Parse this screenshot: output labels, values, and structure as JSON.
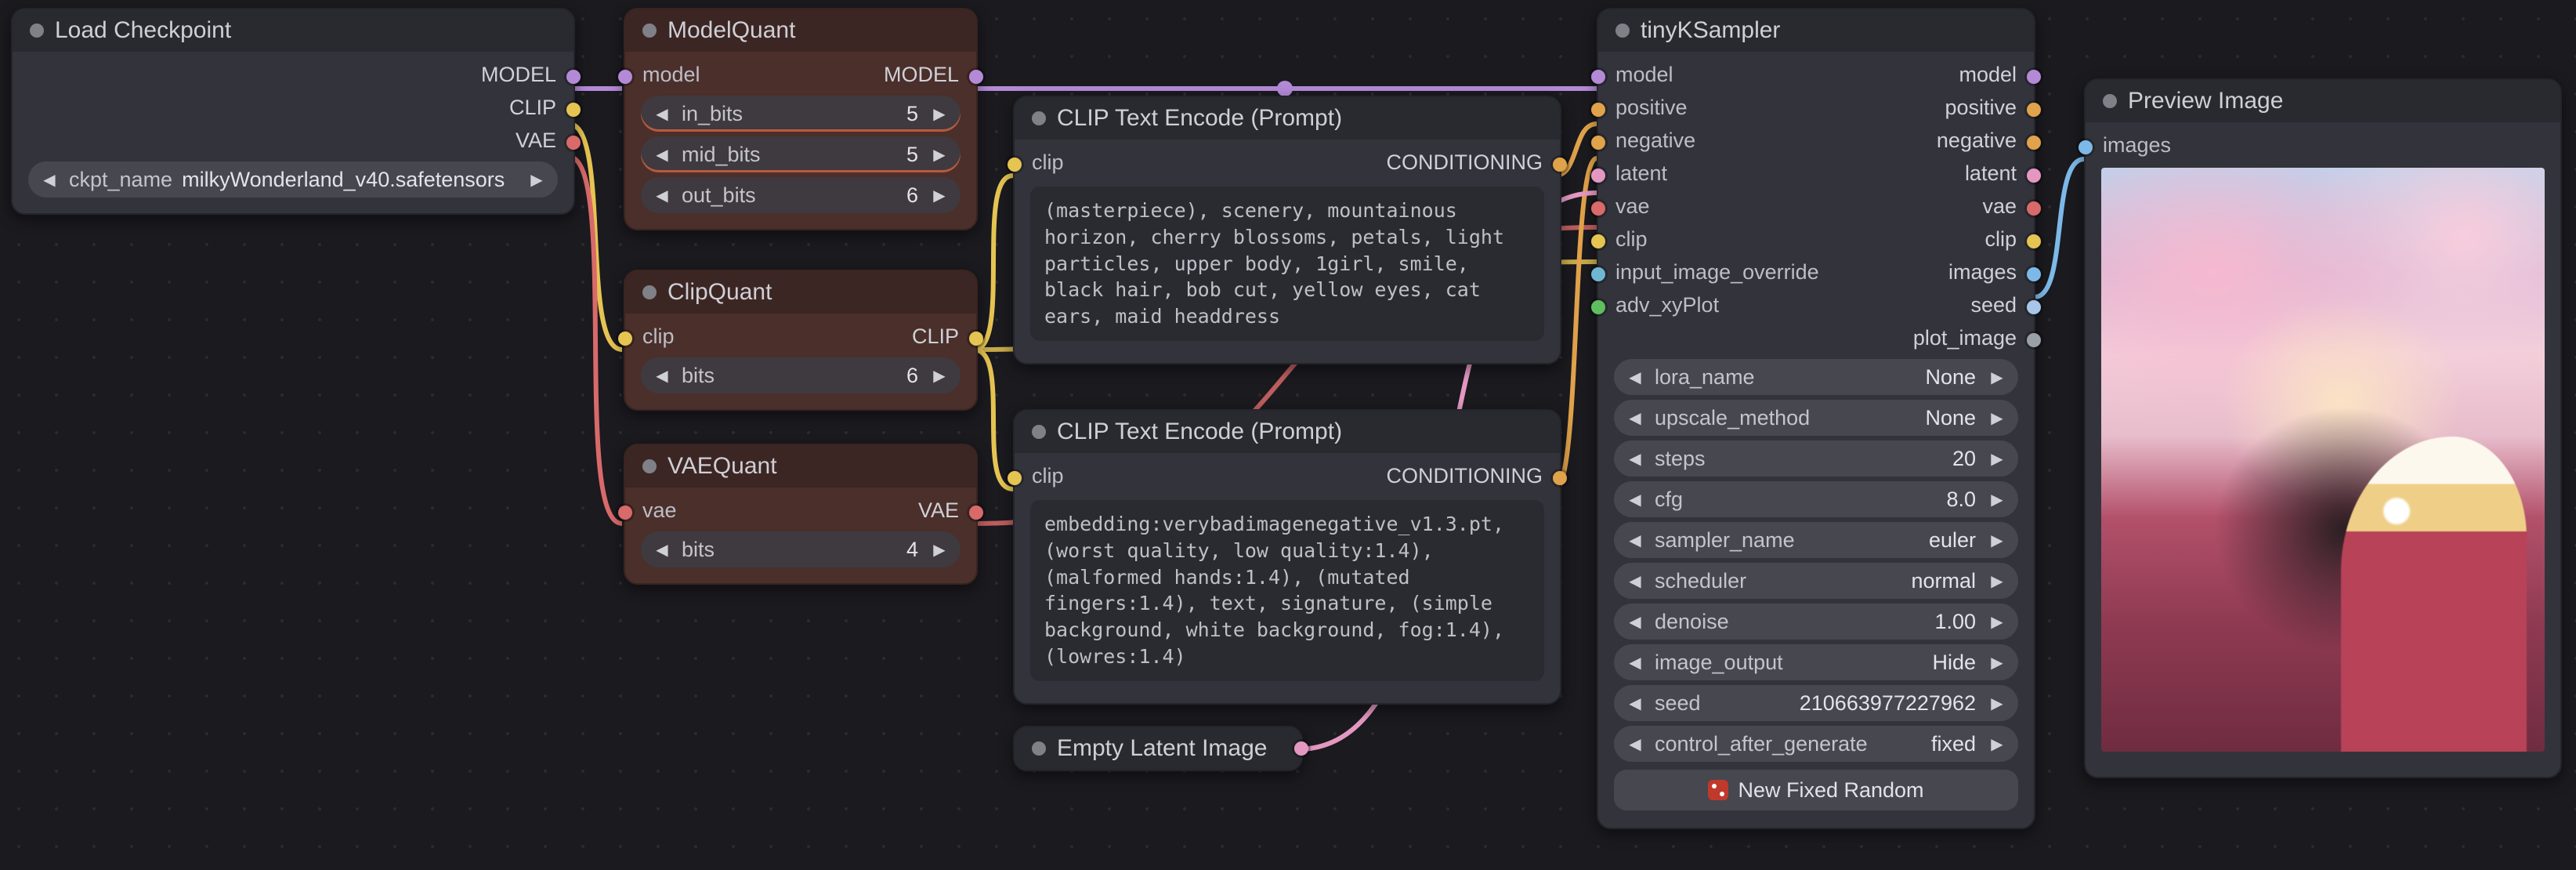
{
  "nodes": {
    "load_checkpoint": {
      "title": "Load Checkpoint",
      "outputs": {
        "model": "MODEL",
        "clip": "CLIP",
        "vae": "VAE"
      },
      "ckpt_name_label": "ckpt_name",
      "ckpt_name_value": "milkyWonderland_v40.safetensors"
    },
    "model_quant": {
      "title": "ModelQuant",
      "inputs": {
        "model": "model"
      },
      "outputs": {
        "model": "MODEL"
      },
      "params": [
        {
          "name": "in_bits",
          "value": "5"
        },
        {
          "name": "mid_bits",
          "value": "5"
        },
        {
          "name": "out_bits",
          "value": "6"
        }
      ]
    },
    "clip_quant": {
      "title": "ClipQuant",
      "inputs": {
        "clip": "clip"
      },
      "outputs": {
        "clip": "CLIP"
      },
      "params": [
        {
          "name": "bits",
          "value": "6"
        }
      ]
    },
    "vae_quant": {
      "title": "VAEQuant",
      "inputs": {
        "vae": "vae"
      },
      "outputs": {
        "vae": "VAE"
      },
      "params": [
        {
          "name": "bits",
          "value": "4"
        }
      ]
    },
    "clip_text_pos": {
      "title": "CLIP Text Encode (Prompt)",
      "inputs": {
        "clip": "clip"
      },
      "outputs": {
        "conditioning": "CONDITIONING"
      },
      "text": "(masterpiece), scenery, mountainous horizon, cherry blossoms, petals, light particles, upper body, 1girl, smile, black hair, bob cut, yellow eyes, cat ears, maid headdress"
    },
    "clip_text_neg": {
      "title": "CLIP Text Encode (Prompt)",
      "inputs": {
        "clip": "clip"
      },
      "outputs": {
        "conditioning": "CONDITIONING"
      },
      "text": "embedding:verybadimagenegative_v1.3.pt, (worst quality, low quality:1.4), (malformed hands:1.4), (mutated fingers:1.4), text, signature, (simple background, white background, fog:1.4), (lowres:1.4)"
    },
    "empty_latent": {
      "title": "Empty Latent Image"
    },
    "tiny_ksampler": {
      "title": "tinyKSampler",
      "inputs": {
        "model": "model",
        "positive": "positive",
        "negative": "negative",
        "latent": "latent",
        "vae": "vae",
        "clip": "clip",
        "input_image_override": "input_image_override",
        "adv_xyPlot": "adv_xyPlot"
      },
      "outputs": {
        "model": "model",
        "positive": "positive",
        "negative": "negative",
        "latent": "latent",
        "vae": "vae",
        "clip": "clip",
        "images": "images",
        "seed": "seed",
        "plot_image": "plot_image"
      },
      "params": [
        {
          "name": "lora_name",
          "value": "None"
        },
        {
          "name": "upscale_method",
          "value": "None"
        },
        {
          "name": "steps",
          "value": "20"
        },
        {
          "name": "cfg",
          "value": "8.0"
        },
        {
          "name": "sampler_name",
          "value": "euler"
        },
        {
          "name": "scheduler",
          "value": "normal"
        },
        {
          "name": "denoise",
          "value": "1.00"
        },
        {
          "name": "image_output",
          "value": "Hide"
        },
        {
          "name": "seed",
          "value": "210663977227962"
        },
        {
          "name": "control_after_generate",
          "value": "fixed"
        }
      ],
      "button": "New Fixed Random"
    },
    "preview_image": {
      "title": "Preview Image",
      "inputs": {
        "images": "images"
      }
    }
  },
  "glyphs": {
    "arrow_left": "◀",
    "arrow_right": "▶"
  }
}
